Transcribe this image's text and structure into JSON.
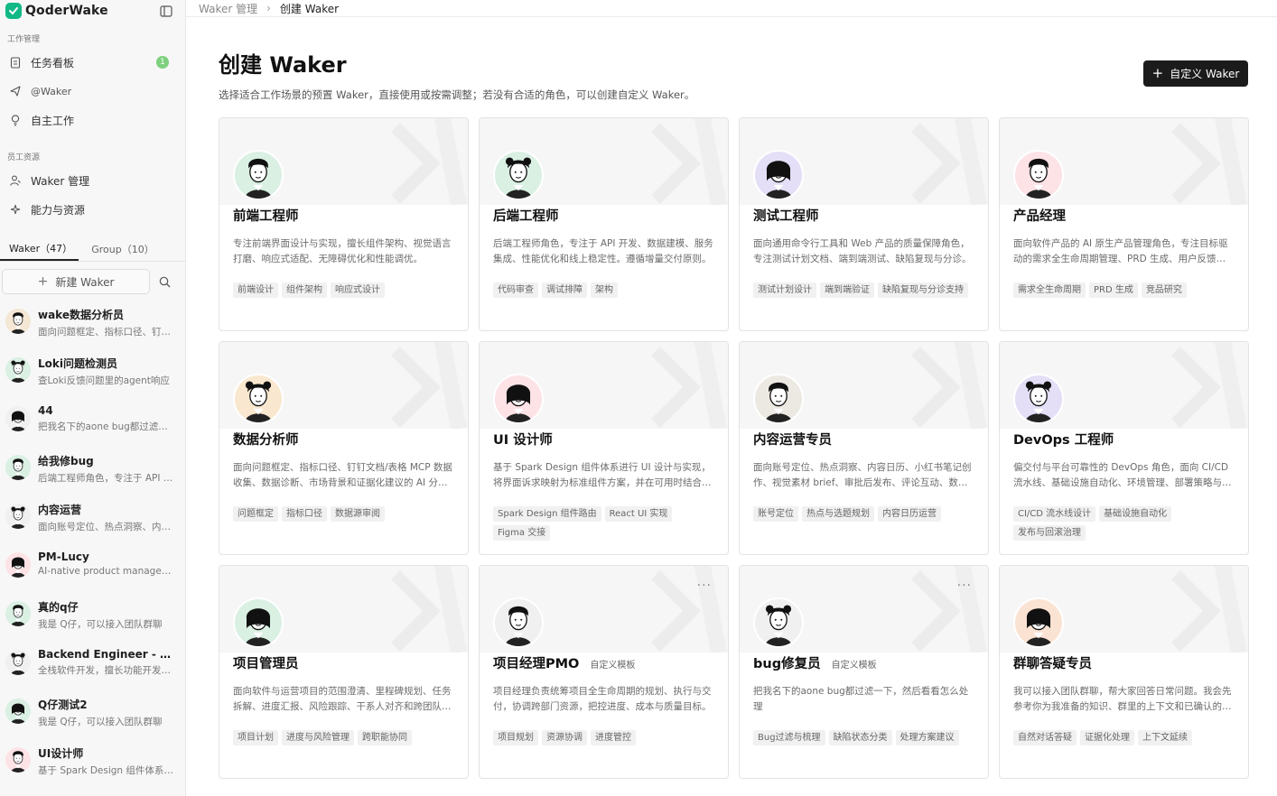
{
  "brand": {
    "name": "QoderWake"
  },
  "sidebar": {
    "section_work": "工作管理",
    "work_items": [
      {
        "label": "任务看板",
        "badge": "1"
      },
      {
        "label": "@Waker"
      },
      {
        "label": "自主工作"
      }
    ],
    "section_staff": "员工资源",
    "staff_items": [
      {
        "label": "Waker 管理"
      },
      {
        "label": "能力与资源"
      }
    ],
    "tabs": [
      {
        "label": "Waker（47）"
      },
      {
        "label": "Group（10）"
      }
    ],
    "new_button": "新建 Waker",
    "wakers": [
      {
        "name": "wake数据分析员",
        "desc": "面向问题框定、指标口径、钉钉文档/表格",
        "color": "#f4e7d3"
      },
      {
        "name": "Loki问题检测员",
        "desc": "查Loki反馈问题里的agent响应",
        "color": "#d9f0e3"
      },
      {
        "name": "44",
        "desc": "把我名下的aone bug都过滤一下",
        "color": "#f0f0f0"
      },
      {
        "name": "给我修bug",
        "desc": "后端工程师角色，专注于 API 开发",
        "color": "#d9f0e3"
      },
      {
        "name": "内容运营",
        "desc": "面向账号定位、热点洞察、内容日历",
        "color": "#f0f0f0"
      },
      {
        "name": "PM-Lucy",
        "desc": "AI-native product management",
        "color": "#fde2e6"
      },
      {
        "name": "真的q仔",
        "desc": "我是 Q仔，可以接入团队群聊",
        "color": "#d9f0e3"
      },
      {
        "name": "Backend Engineer - Anne",
        "desc": "全栈软件开发，擅长功能开发与调试",
        "color": "#f0f0f0"
      },
      {
        "name": "Q仔测试2",
        "desc": "我是 Q仔，可以接入团队群聊",
        "color": "#d9f0e3"
      },
      {
        "name": "UI设计师",
        "desc": "基于 Spark Design 组件体系进行",
        "color": "#fde2e6"
      }
    ]
  },
  "breadcrumb": {
    "parent": "Waker 管理",
    "current": "创建 Waker"
  },
  "header": {
    "title": "创建 Waker",
    "subtitle": "选择适合工作场景的预置 Waker，直接使用或按需调整；若没有合适的角色，可以创建自定义 Waker。",
    "custom_button": "自定义 Waker"
  },
  "cards": [
    {
      "title": "前端工程师",
      "tag": "",
      "desc": "专注前端界面设计与实现，擅长组件架构、视觉语言打磨、响应式适配、无障碍优化和性能调优。",
      "chips": [
        "前端设计",
        "组件架构",
        "响应式设计"
      ],
      "color": "#d9f0e3",
      "more": false
    },
    {
      "title": "后端工程师",
      "tag": "",
      "desc": "后端工程师角色，专注于 API 开发、数据建模、服务集成、性能优化和线上稳定性。遵循增量交付原则。",
      "chips": [
        "代码审查",
        "调试排障",
        "架构"
      ],
      "color": "#d9f0e3",
      "more": false
    },
    {
      "title": "测试工程师",
      "tag": "",
      "desc": "面向通用命令行工具和 Web 产品的质量保障角色，专注测试计划文档、端到端测试、缺陷复现与分诊。",
      "chips": [
        "测试计划设计",
        "端到端验证",
        "缺陷复现与分诊支持"
      ],
      "color": "#e4dff7",
      "more": false
    },
    {
      "title": "产品经理",
      "tag": "",
      "desc": "面向软件产品的 AI 原生产品管理角色，专注目标驱动的需求全生命周期管理、PRD 生成、用户反馈分析。",
      "chips": [
        "需求全生命周期",
        "PRD 生成",
        "竞品研究"
      ],
      "color": "#fde2e6",
      "more": false
    },
    {
      "title": "数据分析师",
      "tag": "",
      "desc": "面向问题框定、指标口径、钉钉文档/表格 MCP 数据收集、数据诊断、市场背景和证据化建议的 AI 分析角色。",
      "chips": [
        "问题框定",
        "指标口径",
        "数据源审阅"
      ],
      "color": "#f9e7cf",
      "more": false
    },
    {
      "title": "UI 设计师",
      "tag": "",
      "desc": "基于 Spark Design 组件体系进行 UI 设计与实现，将界面诉求映射为标准组件方案，并在可用时结合 Figma。",
      "chips": [
        "Spark Design 组件路由",
        "React UI 实现",
        "Figma 交接"
      ],
      "color": "#fde2e6",
      "more": false
    },
    {
      "title": "内容运营专员",
      "tag": "",
      "desc": "面向账号定位、热点洞察、内容日历、小红书笔记创作、视觉素材 brief、审批后发布、评论互动、数据复盘。",
      "chips": [
        "账号定位",
        "热点与选题规划",
        "内容日历运营"
      ],
      "color": "#ece8e2",
      "more": false
    },
    {
      "title": "DevOps 工程师",
      "tag": "",
      "desc": "偏交付与平台可靠性的 DevOps 角色，面向 CI/CD 流水线、基础设施自动化、环境管理、部署策略与回滚。",
      "chips": [
        "CI/CD 流水线设计",
        "基础设施自动化",
        "发布与回滚治理"
      ],
      "color": "#e4dff7",
      "more": false
    },
    {
      "title": "项目管理员",
      "tag": "",
      "desc": "面向软件与运营项目的范围澄清、里程碑规划、任务拆解、进度汇报、风险跟踪、干系人对齐和跨团队协同。",
      "chips": [
        "项目计划",
        "进度与风险管理",
        "跨职能协同"
      ],
      "color": "#d9f0e3",
      "more": false
    },
    {
      "title": "项目经理PMO",
      "tag": "自定义模板",
      "desc": "项目经理负责统筹项目全生命周期的规划、执行与交付，协调跨部门资源，把控进度、成本与质量目标。",
      "chips": [
        "项目规划",
        "资源协调",
        "进度管控"
      ],
      "color": "#f0f0f0",
      "more": true
    },
    {
      "title": "bug修复员",
      "tag": "自定义模板",
      "desc": "把我名下的aone bug都过滤一下，然后看看怎么处理",
      "chips": [
        "Bug过滤与梳理",
        "缺陷状态分类",
        "处理方案建议"
      ],
      "color": "#f0f0f0",
      "more": true
    },
    {
      "title": "群聊答疑专员",
      "tag": "",
      "desc": "我可以接入团队群聊，帮大家回答日常问题。我会先参考你为我准备的知识、群里的上下文和已确认的信息。",
      "chips": [
        "自然对话答疑",
        "证据化处理",
        "上下文延续"
      ],
      "color": "#fbe3d3",
      "more": false
    }
  ]
}
